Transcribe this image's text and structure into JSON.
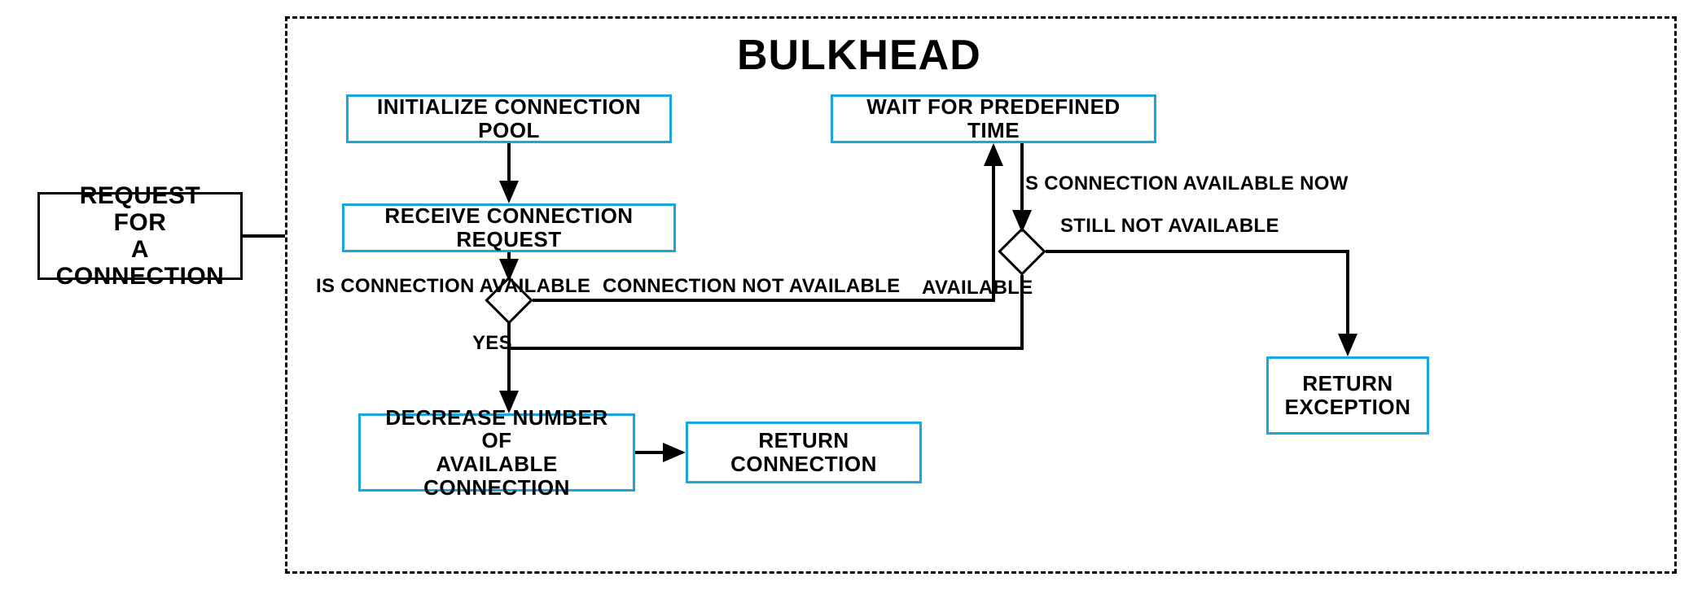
{
  "title": "BULKHEAD",
  "nodes": {
    "request": "REQUEST FOR\nA CONNECTION",
    "init": "INITIALIZE CONNECTION POOL",
    "receive": "RECEIVE CONNECTION REQUEST",
    "wait": "WAIT FOR PREDEFINED TIME",
    "decrease": "DECREASE NUMBER OF\nAVAILABLE CONNECTION",
    "returnConn": "RETURN CONNECTION",
    "returnExc": "RETURN\nEXCEPTION"
  },
  "labels": {
    "isAvail": "IS CONNECTION AVAILABLE",
    "yes": "YES",
    "connNotAvail": "CONNECTION NOT AVAILABLE",
    "isAvailNow": "IS CONNECTION AVAILABLE NOW",
    "stillNot": "STILL NOT AVAILABLE",
    "available": "AVAILABLE"
  }
}
